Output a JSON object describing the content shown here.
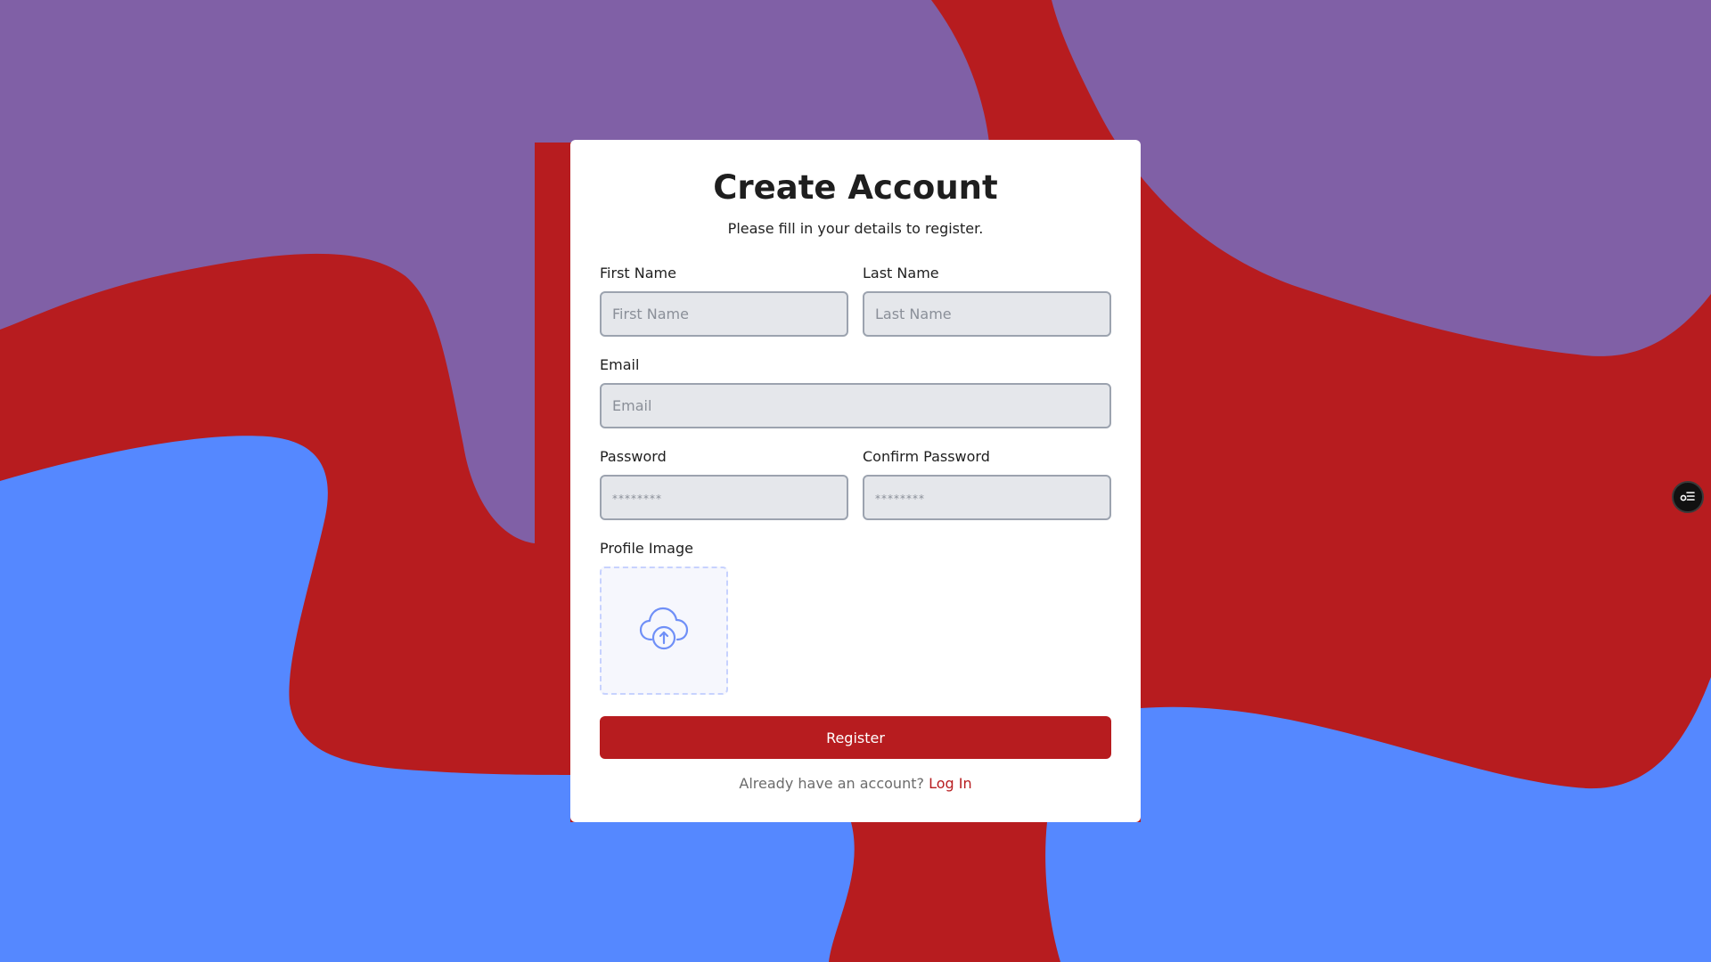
{
  "colors": {
    "background_red": "#b71c1f",
    "background_purple": "#8060a6",
    "background_blue": "#5588ff",
    "accent": "#b71c1f",
    "card": "#ffffff"
  },
  "form": {
    "title": "Create Account",
    "subtitle": "Please fill in your details to register.",
    "first_name": {
      "label": "First Name",
      "placeholder": "First Name",
      "value": ""
    },
    "last_name": {
      "label": "Last Name",
      "placeholder": "Last Name",
      "value": ""
    },
    "email": {
      "label": "Email",
      "placeholder": "Email",
      "value": ""
    },
    "password": {
      "label": "Password",
      "placeholder": "********",
      "value": ""
    },
    "confirm_password": {
      "label": "Confirm Password",
      "placeholder": "********",
      "value": ""
    },
    "profile_image": {
      "label": "Profile Image",
      "icon": "cloud-upload-icon"
    },
    "register_button": "Register",
    "footer_text": "Already have an account?",
    "login_link": "Log In"
  },
  "floating_action": {
    "icon": "settings-list-icon"
  }
}
